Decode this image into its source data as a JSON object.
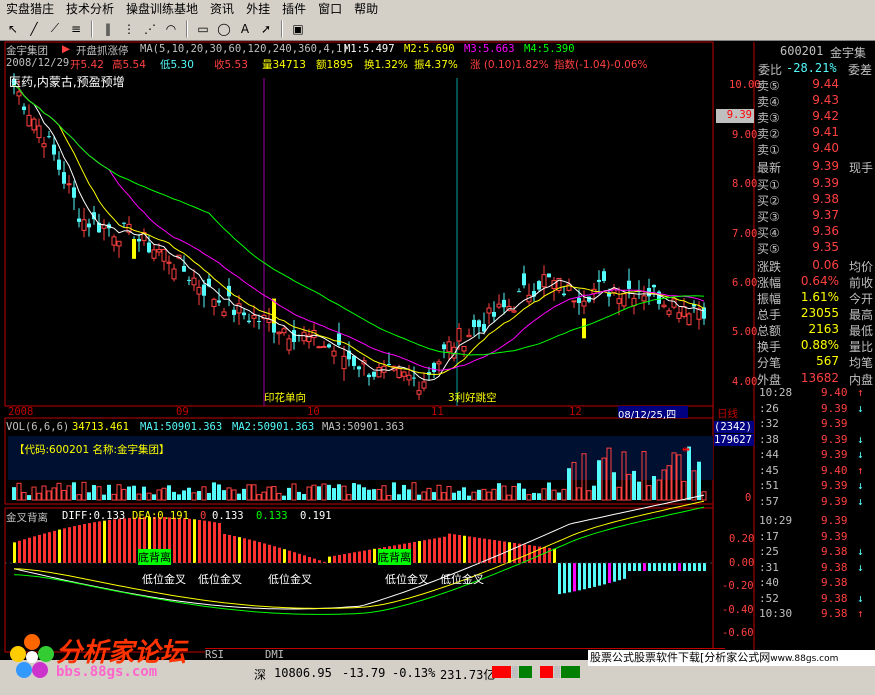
{
  "menu": [
    "实盘猎庄",
    "技术分析",
    "操盘训练基地",
    "资讯",
    "外挂",
    "插件",
    "窗口",
    "帮助"
  ],
  "chart_header": {
    "stock_name": "金宇集团",
    "formula": "开盘抓涨停",
    "ma_params": "MA(5,10,20,30,60,120,240,360,4,1)",
    "m1": "M1:5.497",
    "m2": "M2:5.690",
    "m3": "M3:5.663",
    "m4": "M4:5.390"
  },
  "bar_info": {
    "date": "2008/12/29",
    "open": "开5.42",
    "high": "高5.54",
    "low": "低5.30",
    "close": "收5.53",
    "volume": "量34713",
    "amount": "额1895",
    "turnover": "换1.32%",
    "amplitude": "振4.37%",
    "change": "涨 (0.10)1.82%",
    "index": "指数(-1.04)-0.06%"
  },
  "note": "医药,内蒙古,预盈预增",
  "annotations": {
    "stamp": "印花单向",
    "news": "3利好跳空",
    "divergence1": "底背离",
    "divergence2": "底背离",
    "lowcross1": "低位金叉",
    "lowcross2": "低位金叉",
    "lowcross3": "低位金叉",
    "lowcross4": "低位金叉",
    "lowcross5": "低位金叉"
  },
  "price_axis": [
    "10.00",
    "9.00",
    "8.00",
    "7.00",
    "6.00",
    "5.00",
    "4.00"
  ],
  "price_marker": "9.39",
  "time_axis": {
    "y2008": "2008",
    "m09": "09",
    "m10": "10",
    "m11": "11",
    "m12": "12",
    "cursor": "08/12/25,四",
    "right": "日线"
  },
  "vol_header": {
    "title": "VOL(6,6,6)",
    "value": "34713.461",
    "ma1": "MA1:50901.363",
    "ma2": "MA2:50901.363",
    "ma3": "MA3:50901.363"
  },
  "vol_axis": {
    "top1": "(2342)",
    "top2": "179627",
    "zero": "0"
  },
  "code_box": "【代码:600201 名称:金宇集团】",
  "macd_header": {
    "title": "金叉背离",
    "diff": "DIFF:0.133",
    "dea": "DEA:0.191",
    "v0": "0",
    "v1": "0.133",
    "v2": "0.133",
    "v3": "0.191"
  },
  "macd_axis": [
    "0.20",
    "0.00",
    "-0.20",
    "-0.40",
    "-0.60"
  ],
  "right_panel": {
    "code": "600201",
    "name": "金宇集",
    "weibi_label": "委比",
    "weibi_value": "-28.21%",
    "weicha_label": "委差",
    "sells": [
      {
        "label": "卖⑤",
        "price": "9.44"
      },
      {
        "label": "卖④",
        "price": "9.43"
      },
      {
        "label": "卖③",
        "price": "9.42"
      },
      {
        "label": "卖②",
        "price": "9.41"
      },
      {
        "label": "卖①",
        "price": "9.40"
      }
    ],
    "latest_label": "最新",
    "latest_price": "9.39",
    "current_label": "现手",
    "buys": [
      {
        "label": "买①",
        "price": "9.39"
      },
      {
        "label": "买②",
        "price": "9.38"
      },
      {
        "label": "买③",
        "price": "9.37"
      },
      {
        "label": "买④",
        "price": "9.36"
      },
      {
        "label": "买⑤",
        "price": "9.35"
      }
    ],
    "stats": [
      {
        "label": "涨跌",
        "value": "0.06",
        "side": "均价"
      },
      {
        "label": "涨幅",
        "value": "0.64%",
        "side": "前收"
      },
      {
        "label": "振幅",
        "value": "1.61%",
        "side": "今开"
      },
      {
        "label": "总手",
        "value": "23055",
        "side": "最高"
      },
      {
        "label": "总额",
        "value": "2163",
        "side": "最低"
      },
      {
        "label": "换手",
        "value": "0.88%",
        "side": "量比"
      },
      {
        "label": "分笔",
        "value": "567",
        "side": "均笔"
      }
    ],
    "outer_label": "外盘",
    "outer_value": "13682",
    "inner_label": "内盘",
    "ticks": [
      {
        "t": "10:28",
        "p": "9.40",
        "a": "↑"
      },
      {
        "t": ":26",
        "p": "9.39",
        "a": "↓"
      },
      {
        "t": ":32",
        "p": "9.39",
        "a": ""
      },
      {
        "t": ":38",
        "p": "9.39",
        "a": "↓"
      },
      {
        "t": ":44",
        "p": "9.39",
        "a": "↓"
      },
      {
        "t": ":45",
        "p": "9.40",
        "a": "↑"
      },
      {
        "t": ":51",
        "p": "9.39",
        "a": "↓"
      },
      {
        "t": ":57",
        "p": "9.39",
        "a": "↓"
      },
      {
        "t": "10:29",
        "p": "9.39",
        "a": ""
      },
      {
        "t": ":17",
        "p": "9.39",
        "a": ""
      },
      {
        "t": ":25",
        "p": "9.38",
        "a": "↓"
      },
      {
        "t": ":31",
        "p": "9.38",
        "a": "↓"
      },
      {
        "t": ":40",
        "p": "9.38",
        "a": ""
      },
      {
        "t": ":52",
        "p": "9.38",
        "a": "↓"
      },
      {
        "t": "10:30",
        "p": "9.38",
        "a": "↑"
      }
    ]
  },
  "tabs": [
    "RSI",
    "DMI"
  ],
  "status": {
    "index_label": "深",
    "index_value": "10806.95",
    "index_change": "-13.79",
    "index_pct": "-0.13%",
    "index_amount": "231.73亿",
    "ad": "股票公式股票软件下载[分析家公式网",
    "ad_url": "www.88gs.com"
  },
  "watermark": {
    "title": "分析家论坛",
    "url": "bbs.88gs.com"
  },
  "colors": {
    "up": "#ff4040",
    "down": "#54fcfc",
    "ma_white": "#ffffff",
    "ma_yellow": "#ffff00",
    "ma_magenta": "#ff00ff",
    "ma_green": "#00ff00",
    "axis_red": "#c00000"
  }
}
